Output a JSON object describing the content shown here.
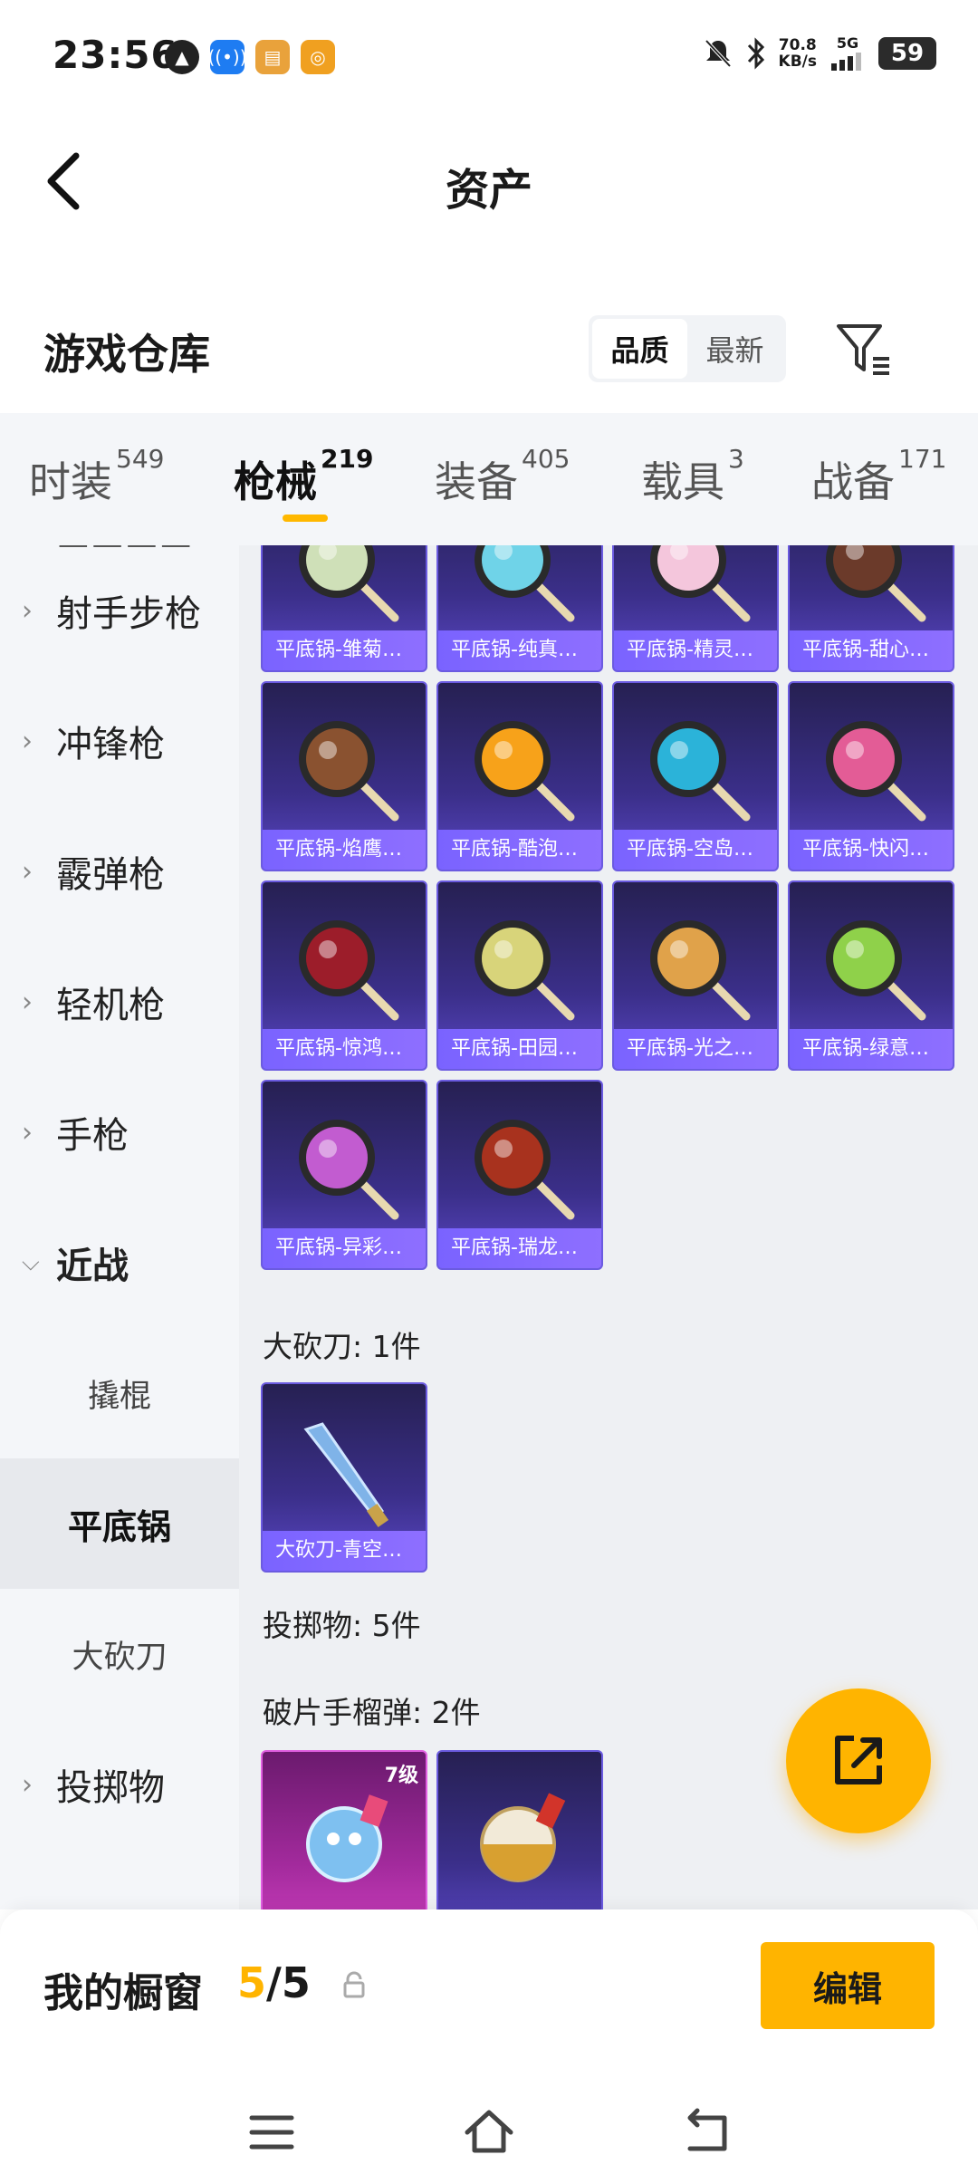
{
  "status_bar": {
    "time": "23:56",
    "net_speed": "70.8",
    "net_unit": "KB/s",
    "signal": "5G",
    "battery": "59",
    "icons": [
      "flame-icon",
      "radio-app-icon",
      "news-app-icon",
      "target-app-icon",
      "mute-icon",
      "bluetooth-icon",
      "signal-icon"
    ]
  },
  "header": {
    "title": "资产"
  },
  "warehouse": {
    "title": "游戏仓库",
    "sort_options": [
      "品质",
      "最新"
    ],
    "sort_selected": "品质"
  },
  "tabs": [
    {
      "label": "时装",
      "count": "549"
    },
    {
      "label": "枪械",
      "count": "219"
    },
    {
      "label": "装备",
      "count": "405"
    },
    {
      "label": "载具",
      "count": "3"
    },
    {
      "label": "战备",
      "count": "171"
    }
  ],
  "active_tab": "枪械",
  "sidebar": {
    "categories": [
      {
        "label": "射手步枪"
      },
      {
        "label": "冲锋枪"
      },
      {
        "label": "霰弹枪"
      },
      {
        "label": "轻机枪"
      },
      {
        "label": "手枪"
      },
      {
        "label": "近战"
      },
      {
        "label": "投掷物"
      }
    ],
    "melee_sub": [
      {
        "label": "撬棍"
      },
      {
        "label": "平底锅"
      },
      {
        "label": "大砍刀"
      }
    ],
    "active_sub": "平底锅"
  },
  "main": {
    "pan_items": [
      {
        "label": "平底锅-雏菊…",
        "color": "#cfe0b8"
      },
      {
        "label": "平底锅-纯真…",
        "color": "#6fd3e8"
      },
      {
        "label": "平底锅-精灵…",
        "color": "#f4c6dc"
      },
      {
        "label": "平底锅-甜心…",
        "color": "#6b3a2a"
      },
      {
        "label": "平底锅-焰鹰…",
        "color": "#8a5230"
      },
      {
        "label": "平底锅-酷泡…",
        "color": "#f7a21a"
      },
      {
        "label": "平底锅-空岛…",
        "color": "#2bb3d9"
      },
      {
        "label": "平底锅-快闪…",
        "color": "#e35c96"
      },
      {
        "label": "平底锅-惊鸿…",
        "color": "#9c1d2a"
      },
      {
        "label": "平底锅-田园…",
        "color": "#d8d47a"
      },
      {
        "label": "平底锅-光之…",
        "color": "#e0a24a"
      },
      {
        "label": "平底锅-绿意…",
        "color": "#8fd14a"
      },
      {
        "label": "平底锅-异彩…",
        "color": "#c25cd0"
      },
      {
        "label": "平底锅-瑞龙…",
        "color": "#a8321e"
      }
    ],
    "machete_section": "大砍刀: 1件",
    "machete_items": [
      {
        "label": "大砍刀-青空…"
      }
    ],
    "throwable_section": "投掷物: 5件",
    "grenade_section": "破片手榴弹: 2件",
    "grenade_items": [
      {
        "label": "",
        "level": "7级"
      },
      {
        "label": "",
        "level": ""
      }
    ]
  },
  "showcase": {
    "title": "我的橱窗",
    "current": "5",
    "separator": "/",
    "total": "5",
    "edit_label": "编辑"
  }
}
